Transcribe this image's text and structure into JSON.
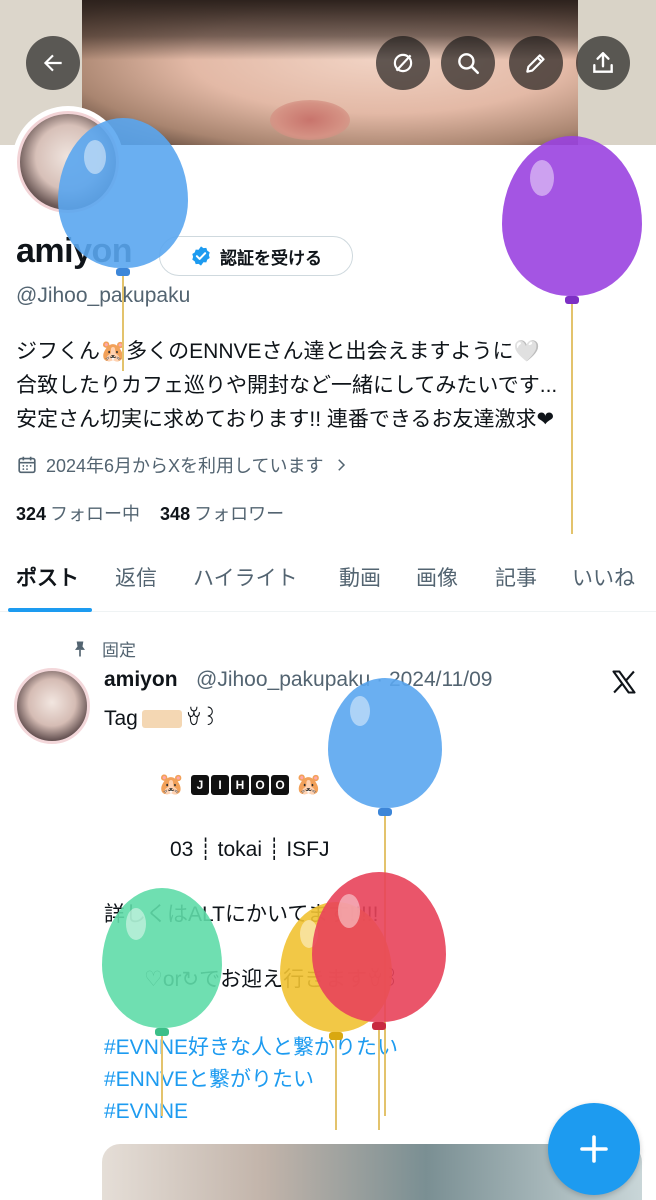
{
  "header": {
    "back_icon": "arrow-left-icon",
    "buttons": [
      "circle-slash-icon",
      "search-icon",
      "edit-pencil-icon",
      "share-upload-icon"
    ]
  },
  "profile": {
    "display_name": "amiyon",
    "verify_button_label": "認証を受ける",
    "handle": "@Jihoo_pakupaku",
    "bio_lines": [
      "ジフくん🐹多くのENNVEさん達と出会えますように🤍",
      "合致したりカフェ巡りや開封など一緒にしてみたいです...",
      "安定さん切実に求めております!! 連番できるお友達激求❤"
    ],
    "joined": "2024年6月からXを利用しています",
    "following_count": "324",
    "following_label": "フォロー中",
    "followers_count": "348",
    "followers_label": "フォロワー"
  },
  "tabs": [
    {
      "label": "ポスト",
      "active": true
    },
    {
      "label": "返信",
      "active": false
    },
    {
      "label": "ハイライト",
      "active": false
    },
    {
      "label": "動画",
      "active": false
    },
    {
      "label": "画像",
      "active": false
    },
    {
      "label": "記事",
      "active": false
    },
    {
      "label": "いいね",
      "active": false
    }
  ],
  "post": {
    "pinned_label": "固定",
    "author_name": "amiyon",
    "author_meta": "@Jihoo_pakupaku · 2024/11/09",
    "tag_prefix": "Tag",
    "tag_suffix": "ꈊ꒱",
    "jihoo_prefix": "🐹",
    "jihoo_letters": [
      "J",
      "I",
      "H",
      "O",
      "O"
    ],
    "jihoo_suffix": "🐹",
    "info_line": "03 ┊ tokai ┊ ISFJ",
    "alt_line": "詳しくはALTにかいてます!!!!!",
    "greet_line": "♡or↻でお迎え行きますꈊ꒱",
    "hashtags": [
      "#EVNNE好きな人と繋がりたい",
      "#ENNVEと繋がりたい",
      "#EVNNE"
    ]
  },
  "fab_icon": "plus-icon",
  "colors": {
    "accent": "#1d9bf0",
    "text_primary": "#0f1419",
    "text_secondary": "#536471"
  }
}
